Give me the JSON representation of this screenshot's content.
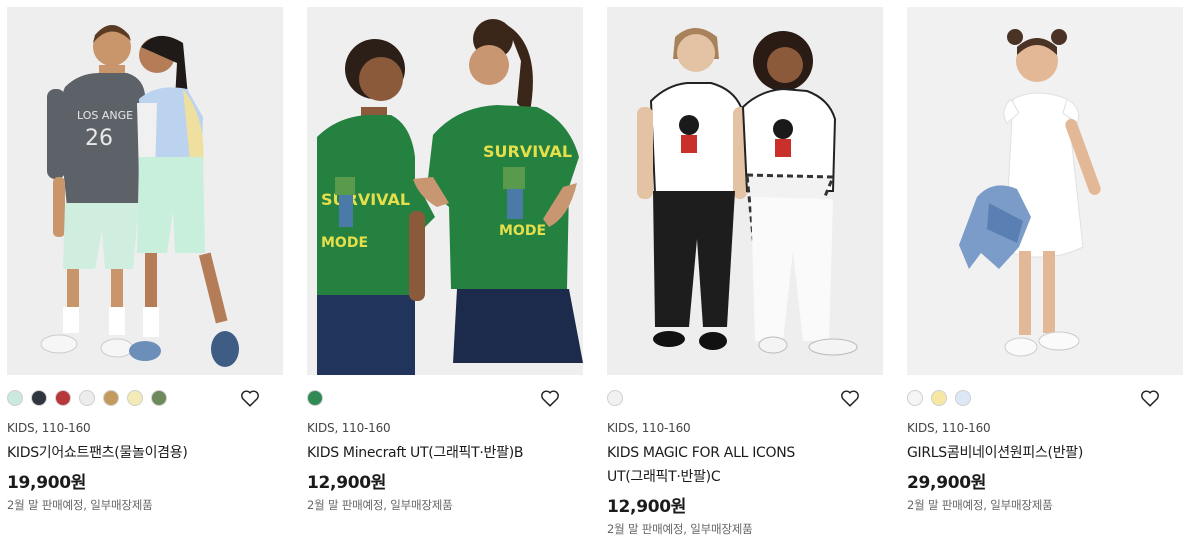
{
  "products": [
    {
      "category": "KIDS, 110-160",
      "name": "KIDS기어쇼트팬츠(물놀이겸용)",
      "price": "19,900원",
      "note": "2월 말 판매예정, 일부매장제품",
      "colors": [
        "#cbe9dc",
        "#2f3640",
        "#b8373b",
        "#ececec",
        "#c39a5e",
        "#f4eab6",
        "#6c8a5b"
      ],
      "image_icon": "kids-shorts-photo"
    },
    {
      "category": "KIDS, 110-160",
      "name": "KIDS Minecraft UT(그래픽T·반팔)B",
      "price": "12,900원",
      "note": "2월 말 판매예정, 일부매장제품",
      "colors": [
        "#2f8a53"
      ],
      "image_icon": "minecraft-tee-photo"
    },
    {
      "category": "KIDS, 110-160",
      "name_line1": "KIDS MAGIC FOR ALL ICONS",
      "name_line2": "UT(그래픽T·반팔)C",
      "price": "12,900원",
      "note": "2월 말 판매예정, 일부매장제품",
      "colors": [
        "#f1f1f1"
      ],
      "image_icon": "mickey-tee-photo"
    },
    {
      "category": "KIDS, 110-160",
      "name": "GIRLS콤비네이션원피스(반팔)",
      "price": "29,900원",
      "note": "2월 말 판매예정, 일부매장제품",
      "colors": [
        "#f5f5f5",
        "#f6e7a3",
        "#dce8f6"
      ],
      "image_icon": "girls-dress-photo"
    }
  ]
}
